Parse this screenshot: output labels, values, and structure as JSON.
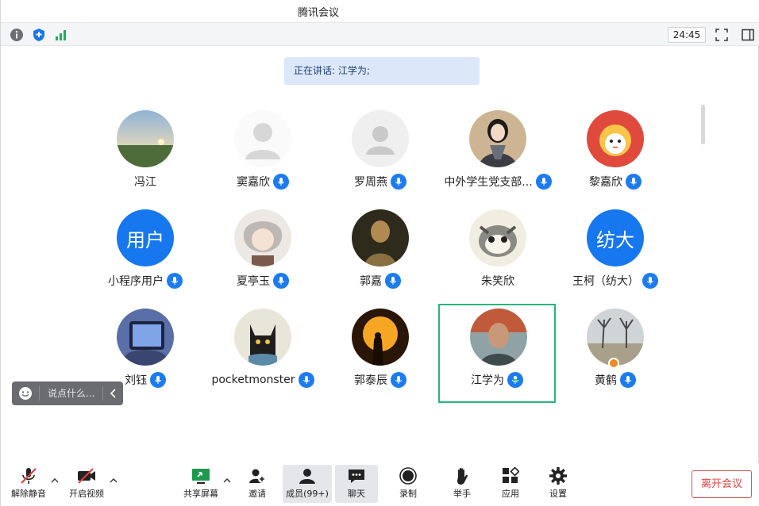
{
  "window": {
    "title": "腾讯会议"
  },
  "statusbar": {
    "timer": "24:45"
  },
  "speaking": {
    "text": "正在讲话: 江学为;"
  },
  "participants": [
    {
      "name": "冯江",
      "mic": false
    },
    {
      "name": "窦嘉欣",
      "mic": true
    },
    {
      "name": "罗周燕",
      "mic": true
    },
    {
      "name": "中外学生党支部...",
      "mic": true
    },
    {
      "name": "黎嘉欣",
      "mic": true
    },
    {
      "name": "小程序用户",
      "mic": true,
      "avatar_text": "用户"
    },
    {
      "name": "夏亭玉",
      "mic": true
    },
    {
      "name": "郭嘉",
      "mic": true
    },
    {
      "name": "朱笑欣",
      "mic": false
    },
    {
      "name": "王柯（纺大）",
      "mic": true,
      "avatar_text": "纺大"
    },
    {
      "name": "刘钰",
      "mic": true
    },
    {
      "name": "pocketmonster",
      "mic": true
    },
    {
      "name": "郭泰辰",
      "mic": true
    },
    {
      "name": "江学为",
      "mic": true,
      "speaking": true
    },
    {
      "name": "黄鹤",
      "mic": true
    }
  ],
  "chat_input": {
    "placeholder": "说点什么..."
  },
  "toolbar": {
    "unmute": "解除静音",
    "start_video": "开启视频",
    "share_screen": "共享屏幕",
    "invite": "邀请",
    "members": "成员(99+)",
    "chat": "聊天",
    "record": "录制",
    "raise_hand": "举手",
    "apps": "应用",
    "settings": "设置",
    "leave": "离开会议"
  },
  "colors": {
    "accent": "#1677ee",
    "speaking_border": "#27b67a",
    "leave": "#e34040"
  }
}
